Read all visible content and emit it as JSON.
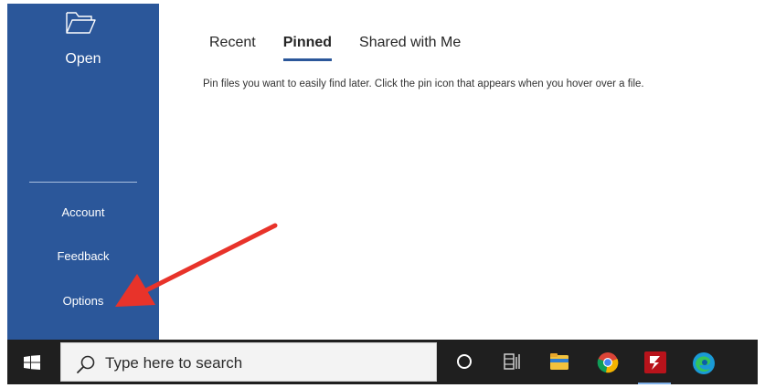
{
  "sidebar": {
    "open_label": "Open",
    "account_label": "Account",
    "feedback_label": "Feedback",
    "options_label": "Options"
  },
  "main": {
    "tabs": [
      {
        "label": "Recent",
        "active": false
      },
      {
        "label": "Pinned",
        "active": true
      },
      {
        "label": "Shared with Me",
        "active": false
      }
    ],
    "hint_text": "Pin files you want to easily find later. Click the pin icon that appears when you hover over a file."
  },
  "taskbar": {
    "search_placeholder": "Type here to search",
    "icons": [
      "start-icon",
      "cortana-icon",
      "task-view-icon",
      "file-explorer-icon",
      "chrome-icon",
      "filezilla-icon",
      "edge-icon"
    ]
  },
  "colors": {
    "sidebar_bg": "#2b579a",
    "taskbar_bg": "#1f1f1f",
    "annotation_arrow": "#e8332a"
  }
}
